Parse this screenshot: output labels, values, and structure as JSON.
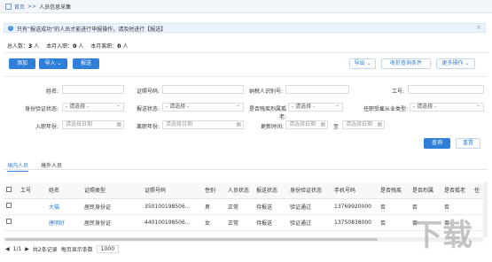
{
  "breadcrumb": {
    "home": "首页",
    "sep": ">>",
    "current": "人员信息采集"
  },
  "notice": "只有“报送成功”的人员才能进行申报操作，请及时进行【报送】",
  "stats": {
    "total_label": "总人数：",
    "total_value": "3",
    "total_unit": "人",
    "join_label": "本月入职：",
    "join_value": "0",
    "join_unit": "人",
    "leave_label": "本月离职：",
    "leave_value": "0",
    "leave_unit": "人"
  },
  "toolbar": {
    "add": "添加",
    "import": "导入",
    "import_arrow": "⌄",
    "submit": "报送",
    "export": "导出",
    "export_arrow": "⌄",
    "collapse": "收折查询条件",
    "more": "更多操作",
    "more_arrow": "⌄"
  },
  "filters": {
    "name_label": "姓名:",
    "idno_label": "证照号码:",
    "taxid_label": "纳税人识别号:",
    "empno_label": "工号:",
    "verify_label": "身份验证状态:",
    "verify_value": "- 请选择 -",
    "report_label": "报送状态:",
    "report_value": "- 请选择 -",
    "disabled_label": "是否残疾烈属孤老:",
    "disabled_value": "- 请选择 -",
    "emptype_label": "任职受雇从业类型:",
    "emptype_value": "- 请选择 -",
    "joindate_label": "入职年份:",
    "joindate_placeholder": "请选择日期",
    "leavedate_label": "离职年份:",
    "leavedate_placeholder": "请选择日期",
    "updated_label": "更新时间:",
    "updated_from_placeholder": "请选择日期",
    "updated_to": "至",
    "updated_to_placeholder": "请选择日期",
    "query": "查询",
    "reset": "重置"
  },
  "tabs": [
    "境内人员",
    "境外人员"
  ],
  "table": {
    "headers": [
      "工号",
      "姓名",
      "证照类型",
      "证照号码",
      "性别",
      "人员状态",
      "报送状态",
      "身份验证状态",
      "手机号码",
      "是否残疾",
      "是否烈属",
      "是否孤老",
      "任"
    ],
    "rows": [
      [
        "",
        "大猫",
        "居民身份证",
        "350100198506...",
        "男",
        "正常",
        "待报送",
        "验证通过",
        "13769920000",
        "否",
        "否",
        "否",
        ""
      ],
      [
        "",
        "唐明好",
        "居民身份证",
        "440100198506...",
        "女",
        "正常",
        "待报送",
        "验证通过",
        "13750838000",
        "否",
        "否",
        "否",
        ""
      ]
    ]
  },
  "footer": {
    "page": "1/1",
    "summary": "共2条记录",
    "per_page_label": "每页显示条数",
    "per_page_value": "1000"
  },
  "colors": {
    "accent": "#2f7fd8"
  }
}
